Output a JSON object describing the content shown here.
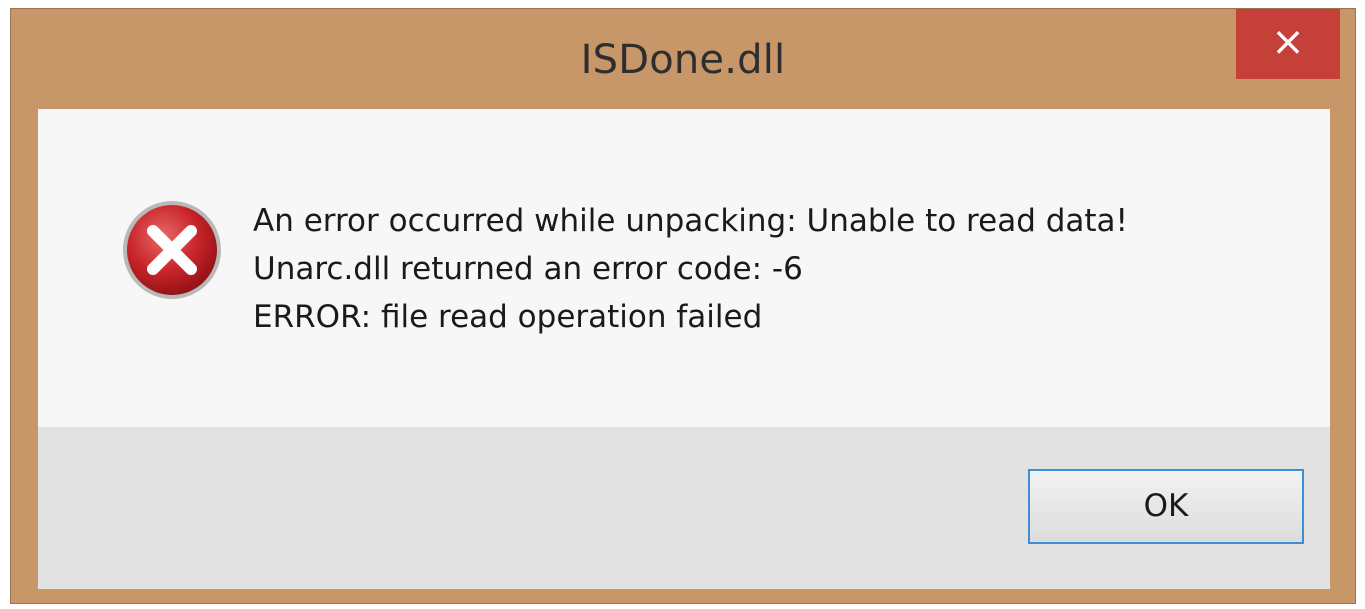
{
  "window": {
    "title": "ISDone.dll",
    "close_glyph": "×"
  },
  "message": {
    "lines": [
      "An error occurred while unpacking: Unable to read data!",
      "Unarc.dll returned an error code: -6",
      "ERROR: file read operation failed"
    ]
  },
  "buttons": {
    "ok_label": "OK"
  },
  "icons": {
    "error": "error-icon",
    "close": "close-icon"
  },
  "colors": {
    "frame": "#c7976a",
    "close_button": "#c6403a",
    "icon_red": "#c8252a",
    "content_bg": "#f7f7f7",
    "footer_bg": "#e2e2e2",
    "ok_border": "#3c8fd6"
  }
}
